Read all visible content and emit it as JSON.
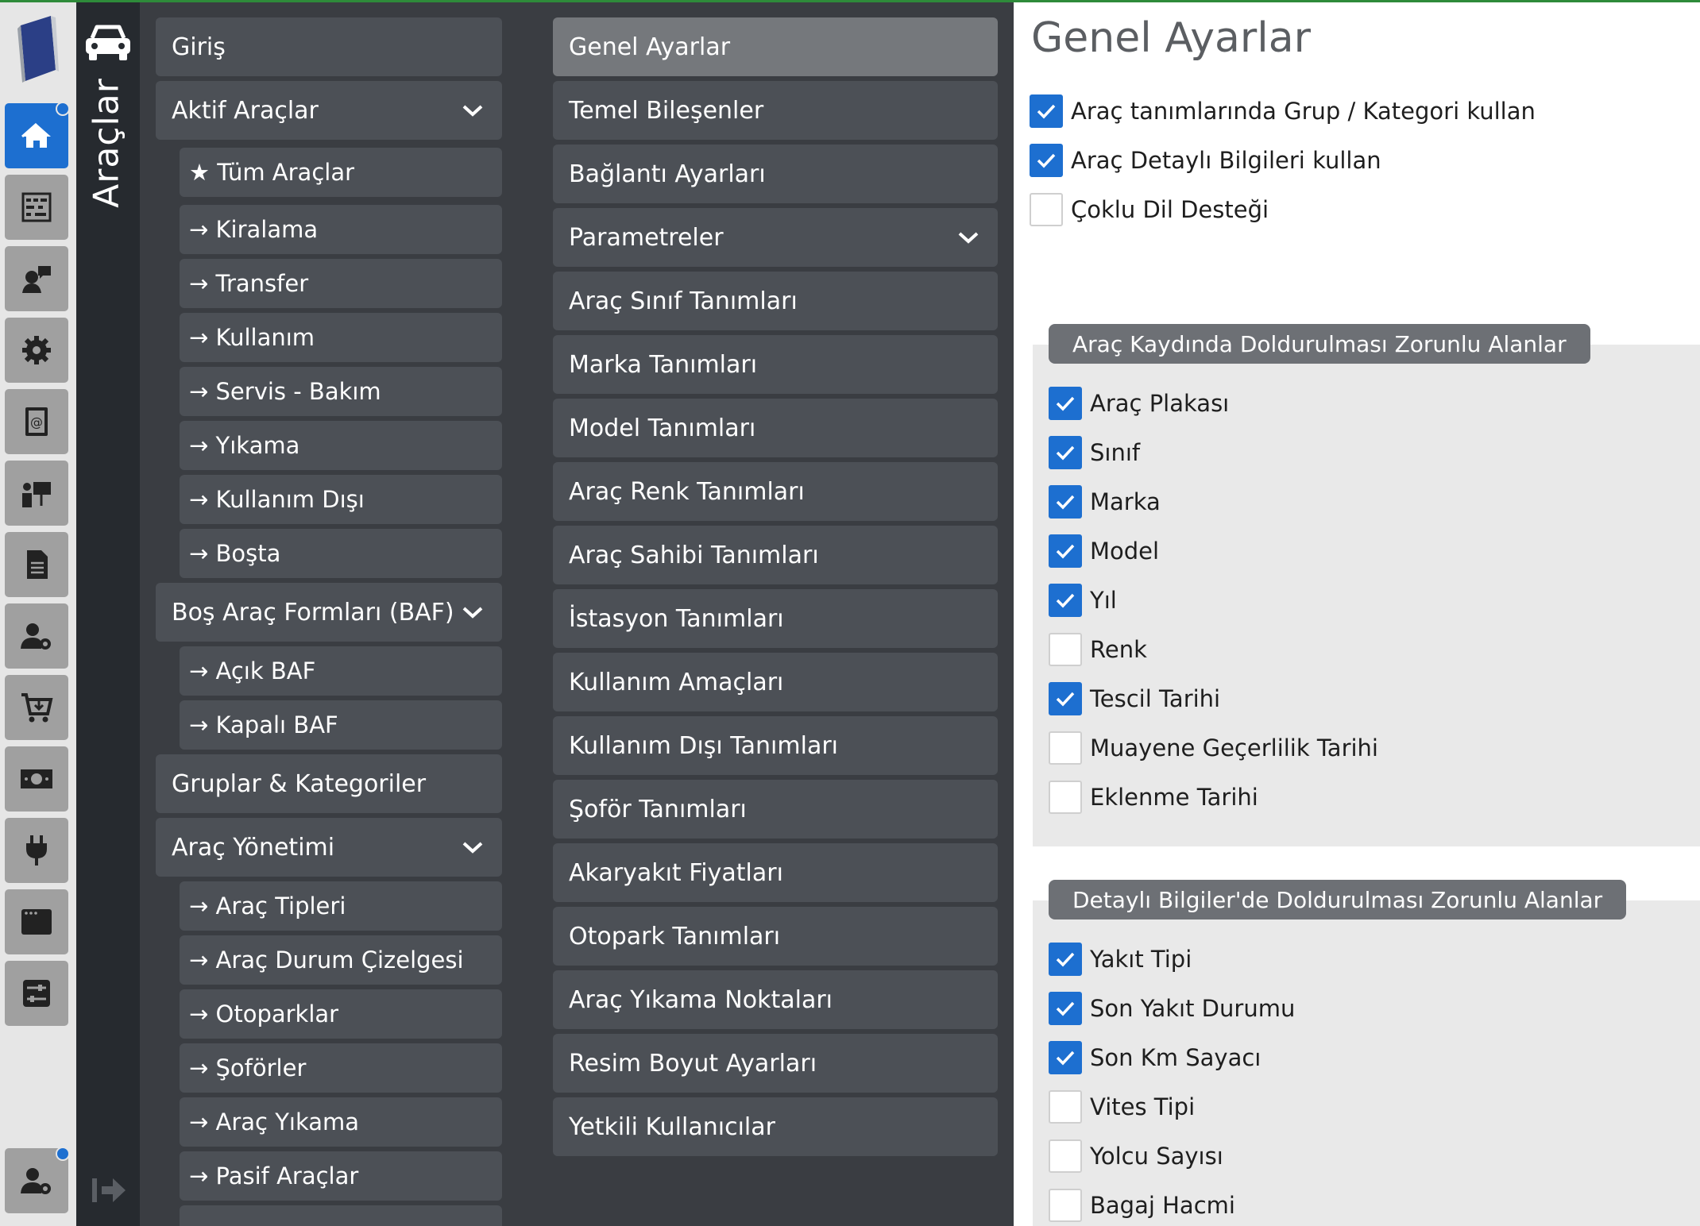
{
  "rail": {
    "icons": [
      "book-logo-icon",
      "home-icon",
      "abacus-icon",
      "user-speech-icon",
      "gear-icon",
      "address-book-icon",
      "presentation-icon",
      "document-icon",
      "user-settings-icon",
      "cart-icon",
      "money-icon",
      "plug-icon",
      "window-icon",
      "sliders-icon",
      "user-settings-icon"
    ]
  },
  "strip": {
    "title": "Araçlar"
  },
  "menu": {
    "giris": "Giriş",
    "aktif": "Aktif Araçlar",
    "aktif_items": [
      "★ Tüm Araçlar",
      "→ Kiralama",
      "→ Transfer",
      "→ Kullanım",
      "→ Servis - Bakım",
      "→ Yıkama",
      "→ Kullanım Dışı",
      "→ Boşta"
    ],
    "baf": "Boş Araç Formları (BAF)",
    "baf_items": [
      "→ Açık BAF",
      "→ Kapalı BAF"
    ],
    "gruplar": "Gruplar & Kategoriler",
    "yonetim": "Araç Yönetimi",
    "yonetim_items": [
      "→ Araç Tipleri",
      "→ Araç Durum Çizelgesi",
      "→ Otoparklar",
      "→ Şoförler",
      "→ Araç Yıkama",
      "→ Pasif Araçlar"
    ]
  },
  "settings_menu": {
    "items": [
      "Genel Ayarlar",
      "Temel Bileşenler",
      "Bağlantı Ayarları",
      "Parametreler",
      "Araç Sınıf Tanımları",
      "Marka Tanımları",
      "Model Tanımları",
      "Araç Renk Tanımları",
      "Araç Sahibi Tanımları",
      "İstasyon Tanımları",
      "Kullanım Amaçları",
      "Kullanım Dışı Tanımları",
      "Şoför Tanımları",
      "Akaryakıt Fiyatları",
      "Otopark Tanımları",
      "Araç Yıkama Noktaları",
      "Resim Boyut Ayarları",
      "Yetkili Kullanıcılar"
    ]
  },
  "main": {
    "title": "Genel Ayarlar",
    "general": [
      {
        "label": "Araç tanımlarında Grup / Kategori kullan",
        "checked": true
      },
      {
        "label": "Araç Detaylı Bilgileri kullan",
        "checked": true
      },
      {
        "label": "Çoklu Dil Desteği",
        "checked": false
      }
    ],
    "required_title": "Araç Kaydında Doldurulması Zorunlu Alanlar",
    "required": [
      {
        "label": "Araç Plakası",
        "checked": true
      },
      {
        "label": "Sınıf",
        "checked": true
      },
      {
        "label": "Marka",
        "checked": true
      },
      {
        "label": "Model",
        "checked": true
      },
      {
        "label": "Yıl",
        "checked": true
      },
      {
        "label": "Renk",
        "checked": false
      },
      {
        "label": "Tescil Tarihi",
        "checked": true
      },
      {
        "label": "Muayene Geçerlilik Tarihi",
        "checked": false
      },
      {
        "label": "Eklenme Tarihi",
        "checked": false
      }
    ],
    "detail_title": "Detaylı Bilgiler'de Doldurulması Zorunlu Alanlar",
    "detail": [
      {
        "label": "Yakıt Tipi",
        "checked": true
      },
      {
        "label": "Son Yakıt Durumu",
        "checked": true
      },
      {
        "label": "Son Km Sayacı",
        "checked": true
      },
      {
        "label": "Vites Tipi",
        "checked": false
      },
      {
        "label": "Yolcu Sayısı",
        "checked": false
      },
      {
        "label": "Bagaj Hacmi",
        "checked": false
      }
    ]
  }
}
